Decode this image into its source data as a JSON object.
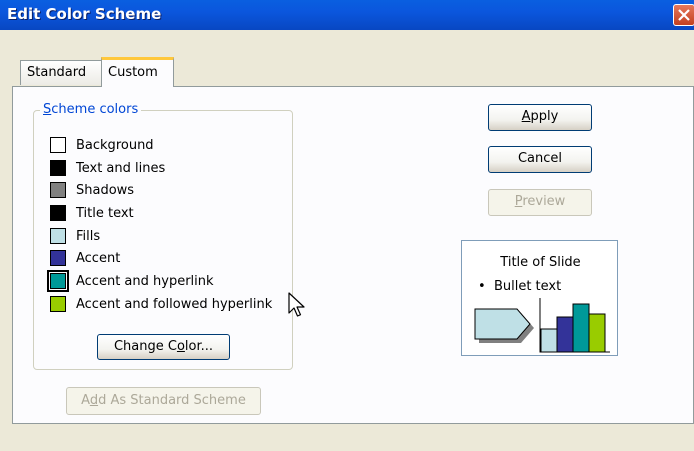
{
  "window": {
    "title": "Edit Color Scheme"
  },
  "tabs": [
    {
      "label": "Standard",
      "active": false
    },
    {
      "label": "Custom",
      "active": true
    }
  ],
  "scheme_colors": {
    "legend_prefix": "",
    "legend_mnemonic": "S",
    "legend_rest": "cheme colors",
    "items": [
      {
        "label": "Background",
        "color": "#ffffff"
      },
      {
        "label": "Text and lines",
        "color": "#000000"
      },
      {
        "label": "Shadows",
        "color": "#808080"
      },
      {
        "label": "Title text",
        "color": "#000000"
      },
      {
        "label": "Fills",
        "color": "#bfe0e6"
      },
      {
        "label": "Accent",
        "color": "#333399"
      },
      {
        "label": "Accent and hyperlink",
        "color": "#009999",
        "selected": true
      },
      {
        "label": "Accent and followed hyperlink",
        "color": "#99cc00"
      }
    ]
  },
  "buttons": {
    "change_color": {
      "pre": "Change C",
      "mn": "o",
      "post": "lor..."
    },
    "add_standard": {
      "pre": "A",
      "mn": "d",
      "post": "d As Standard Scheme"
    },
    "apply": {
      "pre": "",
      "mn": "A",
      "post": "pply"
    },
    "cancel": {
      "label": "Cancel"
    },
    "preview": {
      "pre": "",
      "mn": "P",
      "post": "review"
    }
  },
  "preview": {
    "title": "Title of Slide",
    "bullet": "Bullet text",
    "bar_colors": [
      "#bfe0e6",
      "#333399",
      "#009999",
      "#99cc00"
    ],
    "bar_levels": [
      0.45,
      0.7,
      0.95,
      0.75
    ],
    "arrow_fill": "#bfe0e6",
    "shadow_color": "#808080"
  }
}
